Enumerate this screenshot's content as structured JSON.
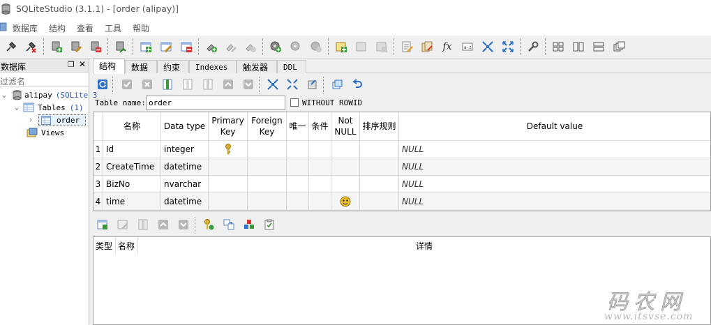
{
  "window": {
    "title": "SQLiteStudio (3.1.1) - [order (alipay)]"
  },
  "menu": [
    "数据库",
    "结构",
    "查看",
    "工具",
    "帮助"
  ],
  "db_panel": {
    "title": "数据库",
    "filter_placeholder": "过滤名",
    "tree": {
      "database": "alipay",
      "database_suffix": "(SQLite 3",
      "tables_label": "Tables",
      "tables_count": "(1)",
      "table_name": "order",
      "views_label": "Views"
    }
  },
  "tabs": [
    "结构",
    "数据",
    "约束",
    "Indexes",
    "触发器",
    "DDL"
  ],
  "table_name": {
    "label": "Table name:",
    "value": "order",
    "without_rowid_label": "WITHOUT ROWID",
    "without_rowid_checked": false
  },
  "columns_grid": {
    "headers": {
      "name": "名称",
      "type": "Data type",
      "pk_line1": "Primary",
      "pk_line2": "Key",
      "fk_line1": "Foreign",
      "fk_line2": "Key",
      "unique": "唯一",
      "check": "条件",
      "notnull_line1": "Not",
      "notnull_line2": "NULL",
      "collate": "排序规则",
      "default": "Default value"
    },
    "rows": [
      {
        "num": "1",
        "name": "Id",
        "type": "integer",
        "pk": true,
        "notnull": false,
        "default": "NULL"
      },
      {
        "num": "2",
        "name": "CreateTime",
        "type": "datetime",
        "pk": false,
        "notnull": false,
        "default": "NULL"
      },
      {
        "num": "3",
        "name": "BizNo",
        "type": "nvarchar",
        "pk": false,
        "notnull": false,
        "default": "NULL"
      },
      {
        "num": "4",
        "name": "time",
        "type": "datetime",
        "pk": false,
        "notnull": true,
        "default": "NULL"
      }
    ]
  },
  "constraints_grid": {
    "headers": {
      "type": "类型",
      "name": "名称",
      "details": "详情"
    }
  },
  "watermark": {
    "big": "码农网",
    "url": "www.itsvse.com"
  },
  "colors": {
    "selection_bg": "#e5f1fb",
    "row_alt": "#f5f5f5",
    "accent_blue": "#2a6fc9",
    "key_gold": "#d8b030"
  }
}
